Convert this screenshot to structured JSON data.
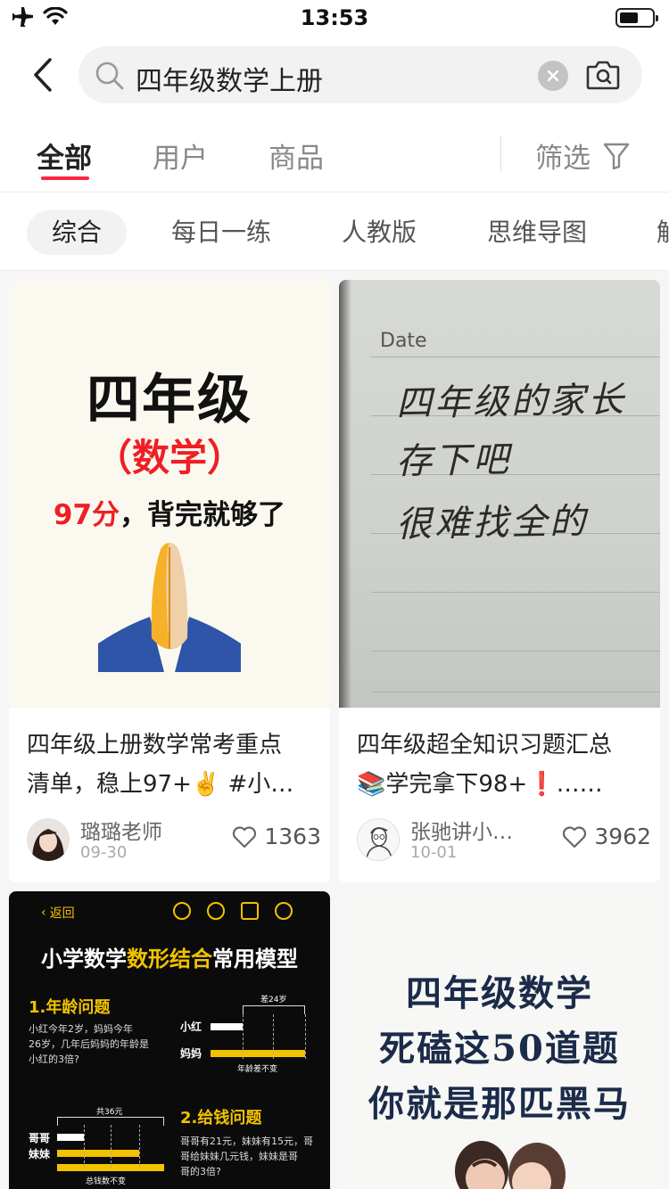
{
  "status_bar": {
    "time": "13:53"
  },
  "search": {
    "query": "四年级数学上册"
  },
  "main_tabs": [
    {
      "label": "全部",
      "active": true
    },
    {
      "label": "用户",
      "active": false
    },
    {
      "label": "商品",
      "active": false
    }
  ],
  "filter": {
    "label": "筛选"
  },
  "sub_tabs": [
    {
      "label": "综合",
      "active": true
    },
    {
      "label": "每日一练",
      "active": false
    },
    {
      "label": "人教版",
      "active": false
    },
    {
      "label": "思维导图",
      "active": false
    },
    {
      "label": "解",
      "active": false
    }
  ],
  "colors": {
    "accent": "#ff2442",
    "title_red": "#ee1f25",
    "gold": "#f2c200"
  },
  "cards": [
    {
      "title_line1": "四年级上册数学常考重点",
      "title_line2": "清单，稳上97+✌️ #小…",
      "author": "璐璐老师",
      "date": "09-30",
      "likes": "1363",
      "image": {
        "line1": "四年级",
        "line2": "（数学）",
        "line3_red": "97分",
        "line3_rest": "，背完就够了",
        "emoji": "folded-hands"
      }
    },
    {
      "title_line1": "四年级超全知识习题汇总",
      "title_line2": "📚学完拿下98+❗……",
      "author": "张驰讲小…",
      "date": "10-01",
      "likes": "3962",
      "image": {
        "date_label": "Date",
        "hand_lines": [
          "四年级的家长",
          "存下吧",
          "很难找全的"
        ]
      }
    },
    {
      "image": {
        "back": "返回",
        "title_a": "小学数学",
        "title_b": "数形结合",
        "title_c": "常用模型",
        "q1_title": "1.年龄问题",
        "q1_text": [
          "小红今年2岁，妈妈今年",
          "26岁，几年后妈妈的年龄是",
          "小红的3倍?"
        ],
        "q1_labels": [
          "小红",
          "妈妈"
        ],
        "q1_diff": "差24岁",
        "q1_note": "年龄差不变",
        "q2_title": "2.给钱问题",
        "q2_text": [
          "哥哥有21元，妹妹有15元，哥",
          "哥给妹妹几元钱，妹妹是哥",
          "哥的3倍?"
        ],
        "q2_labels": [
          "哥哥",
          "妹妹"
        ],
        "q2_total": "共36元",
        "q2_note": "总钱数不变"
      }
    },
    {
      "image": {
        "lines": [
          "四年级数学",
          "死磕这50道题",
          "你就是那匹黑马"
        ]
      }
    }
  ]
}
